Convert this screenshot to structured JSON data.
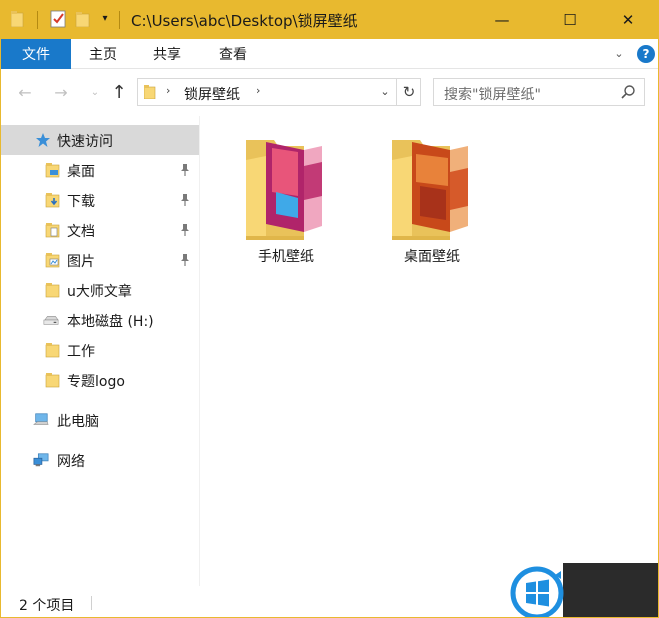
{
  "window": {
    "title": "C:\\Users\\abc\\Desktop\\锁屏壁纸",
    "controls": {
      "minimize": "—",
      "maximize": "☐",
      "close": "✕"
    },
    "qat_dropdown_glyph": "▾"
  },
  "ribbon": {
    "file_tab": "文件",
    "tabs": [
      "主页",
      "共享",
      "查看"
    ],
    "chevron_glyph": "⌄",
    "help_glyph": "?"
  },
  "nav": {
    "back_glyph": "←",
    "forward_glyph": "→",
    "recent_glyph": "⌄",
    "up_glyph": "↑",
    "address": {
      "separator_glyph": "›",
      "path_segment": "锁屏壁纸",
      "dropdown_glyph": "⌄",
      "refresh_glyph": "↻"
    },
    "search": {
      "placeholder": "搜索\"锁屏壁纸\""
    }
  },
  "navpane": {
    "quick_access": "快速访问",
    "items": [
      {
        "label": "桌面",
        "icon": "desktop-folder-icon",
        "pinned": true
      },
      {
        "label": "下载",
        "icon": "downloads-folder-icon",
        "pinned": true
      },
      {
        "label": "文档",
        "icon": "documents-folder-icon",
        "pinned": true
      },
      {
        "label": "图片",
        "icon": "pictures-folder-icon",
        "pinned": true
      },
      {
        "label": "u大师文章",
        "icon": "folder-icon",
        "pinned": false
      },
      {
        "label": "本地磁盘 (H:)",
        "icon": "drive-icon",
        "pinned": false
      },
      {
        "label": "工作",
        "icon": "folder-icon",
        "pinned": false
      },
      {
        "label": "专题logo",
        "icon": "folder-icon",
        "pinned": false
      }
    ],
    "this_pc": "此电脑",
    "network": "网络"
  },
  "content": {
    "folders": [
      {
        "name": "手机壁纸",
        "icon": "picture-folder-icon"
      },
      {
        "name": "桌面壁纸",
        "icon": "picture-folder-icon"
      }
    ]
  },
  "status": {
    "item_count": "2 个项目"
  },
  "colors": {
    "titlebar": "#e8b92f",
    "file_tab": "#1979ca",
    "selected_nav": "#d9d9d9",
    "folder_yellow": "#f8d775"
  }
}
